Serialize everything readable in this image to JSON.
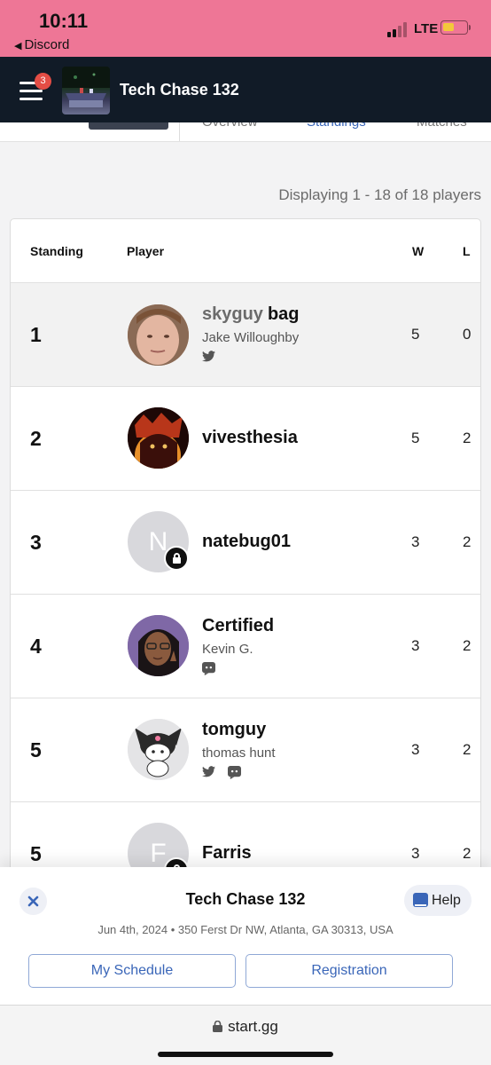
{
  "status_bar": {
    "time": "10:11",
    "back_app": "Discord",
    "network": "LTE",
    "battery_color": "#f3c83b",
    "background": "#ee7696"
  },
  "header": {
    "menu_icon": "hamburger-icon",
    "notification_count": "3",
    "title": "Tech Chase 132",
    "background": "#111b27"
  },
  "tabs": [
    "Overview",
    "Standings",
    "Matches"
  ],
  "summary": "Displaying 1 - 18 of 18 players",
  "table": {
    "columns": {
      "standing": "Standing",
      "player": "Player",
      "w": "W",
      "l": "L"
    },
    "rows": [
      {
        "rank": "1",
        "prefix": "skyguy",
        "gamer_tag": "bag",
        "real_name": "Jake Willoughby",
        "socials": [
          "twitter-icon"
        ],
        "w": "5",
        "l": "0",
        "avatar": "photo",
        "highlighted": true
      },
      {
        "rank": "2",
        "prefix": "",
        "gamer_tag": "vivesthesia",
        "real_name": "",
        "socials": [],
        "w": "5",
        "l": "2",
        "avatar": "art"
      },
      {
        "rank": "3",
        "prefix": "",
        "gamer_tag": "natebug01",
        "real_name": "",
        "socials": [],
        "w": "3",
        "l": "2",
        "avatar": "letter",
        "avatar_letter": "N",
        "locked": true
      },
      {
        "rank": "4",
        "prefix": "",
        "gamer_tag": "Certified",
        "real_name": "Kevin G.",
        "socials": [
          "discord-icon"
        ],
        "w": "3",
        "l": "2",
        "avatar": "cartoon"
      },
      {
        "rank": "5",
        "prefix": "",
        "gamer_tag": "tomguy",
        "real_name": "thomas hunt",
        "socials": [
          "twitter-icon",
          "discord-icon"
        ],
        "w": "3",
        "l": "2",
        "avatar": "kuromi"
      },
      {
        "rank": "5",
        "prefix": "",
        "gamer_tag": "Farris",
        "real_name": "",
        "socials": [],
        "w": "3",
        "l": "2",
        "avatar": "letter",
        "avatar_letter": "F",
        "locked": true
      }
    ]
  },
  "event_panel": {
    "title": "Tech Chase 132",
    "details": "Jun 4th, 2024 • 350 Ferst Dr NW, Atlanta, GA 30313, USA",
    "help_label": "Help",
    "my_schedule_label": "My Schedule",
    "registration_label": "Registration",
    "accent_color": "#3a66b8"
  },
  "browser": {
    "url": "start.gg"
  }
}
